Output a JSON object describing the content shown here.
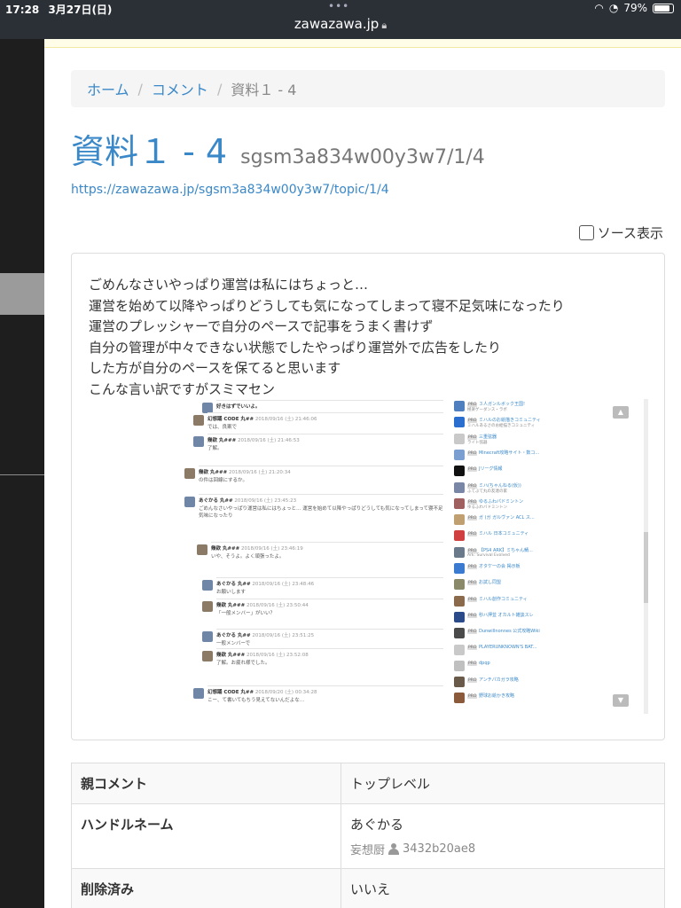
{
  "status_bar": {
    "time": "17:28",
    "date": "3月27日(日)",
    "battery": "79%"
  },
  "browser": {
    "url": "zawazawa.jp"
  },
  "breadcrumb": {
    "home": "ホーム",
    "comments": "コメント",
    "current": "資料１ - 4"
  },
  "page": {
    "title": "資料１ - 4",
    "subtitle": "sgsm3a834w00y3w7/1/4",
    "topic_url": "https://zawazawa.jp/sgsm3a834w00y3w7/topic/1/4",
    "source_toggle_label": "ソース表示"
  },
  "comment": {
    "lines": [
      "ごめんなさいやっぱり運営は私にはちょっと…",
      "運営を始めて以降やっぱりどうしても気になってしまって寝不足気味になったり",
      "運営のプレッシャーで自分のペースで記事をうまく書けず",
      "自分の管理が中々できない状態でしたやっぱり運営外で広告をしたり",
      "した方が自分のペースを保てると思います",
      "こんな言い訳ですがスミマセン"
    ]
  },
  "embed": {
    "rows": [
      {
        "name": "好きはずでいいよ。",
        "id": "",
        "body": ""
      },
      {
        "name": "幻想踊 CODE 丸##",
        "id": "2018/09/16 (土) 21:46:06",
        "body": "では、良案で"
      },
      {
        "name": "幾欲 丸###",
        "id": "2018/09/16 (土) 21:46:53",
        "body": "了解。"
      },
      {
        "name": "幾欲 丸###",
        "id": "2018/09/16 (土) 21:20:34",
        "body": "の件は回線にするか。"
      },
      {
        "name": "あぐかる 丸##",
        "id": "2018/09/16 (土) 23:45:23",
        "body": "ごめんなさいやっぱり運営は私にはちょっと… 運営を始めて以降やっぱりどうしても気になってしまって寝不足気味になったり"
      },
      {
        "name": "幾欲 丸###",
        "id": "2018/09/16 (土) 23:46:19",
        "body": "いや、そうよ。よく頑張ったよ。"
      },
      {
        "name": "あぐかる 丸##",
        "id": "2018/09/16 (土) 23:48:46",
        "body": "お願いします"
      },
      {
        "name": "幾欲 丸###",
        "id": "2018/09/16 (土) 23:50:44",
        "body": "「一般メンバー」がいい？"
      },
      {
        "name": "あぐかる 丸##",
        "id": "2018/09/16 (土) 23:51:25",
        "body": "一般メンバーで"
      },
      {
        "name": "幾欲 丸###",
        "id": "2018/09/16 (土) 23:52:08",
        "body": "了解。お疲れ様でした。"
      },
      {
        "name": "幻想踊 CODE 丸##",
        "id": "2018/09/20 (土) 00:34:28",
        "body": "こー、て書いてもちう見えてないんだよな…"
      }
    ],
    "sidebar": [
      {
        "badge": "PRO",
        "title": "３人ガンルボック王国!",
        "desc": "極楽ゲーダンス・ラボ",
        "color": "#4f7fbf"
      },
      {
        "badge": "PRO",
        "title": "ミハルのお絵描きコミュニティ",
        "desc": "ミハルあるさのお絵描きコミュニティ",
        "color": "#2a6fd0"
      },
      {
        "badge": "PRO",
        "title": "三重弦器",
        "desc": "ライト弦器",
        "color": "#c9c9c9"
      },
      {
        "badge": "PRO",
        "title": "Minecraft攻略サイト・数コ...",
        "desc": "",
        "color": "#7a9fd0"
      },
      {
        "badge": "PRO",
        "title": "Jリーグ情報",
        "desc": "",
        "color": "#111111"
      },
      {
        "badge": "PRO",
        "title": "ミハ(ちゃんねる(仮))",
        "desc": "ふてぶて丸の友達の家",
        "color": "#7a86a6"
      },
      {
        "badge": "PRO",
        "title": "ゆるふわパドミントン",
        "desc": "ゆるふわバドミントン",
        "color": "#a06060"
      },
      {
        "badge": "PRO",
        "title": "ガ (ガ ガルヴァン ACL ス...",
        "desc": "",
        "color": "#c0a070"
      },
      {
        "badge": "PRO",
        "title": "ミハル 日本コミュニティ",
        "desc": "",
        "color": "#d04040"
      },
      {
        "badge": "PRO",
        "title": "【PS4 ARK】ミちゃん鯖...",
        "desc": "Ark: Survival Evolved",
        "color": "#6a7a8a"
      },
      {
        "badge": "PRO",
        "title": "オタケ一の会 掲示板",
        "desc": "",
        "color": "#3a7ad0"
      },
      {
        "badge": "PRO",
        "title": "お試し同盟",
        "desc": "",
        "color": "#8a8a6a"
      },
      {
        "badge": "PRO",
        "title": "ミハル創作コミュニティ",
        "desc": "",
        "color": "#8a6a4a"
      },
      {
        "badge": "PRO",
        "title": "秒ハ押並 オカルト雑談スレ",
        "desc": "",
        "color": "#2a4a8a"
      },
      {
        "badge": "PRO",
        "title": "Dunwillnonnes 公式攻略Wiki",
        "desc": "",
        "color": "#4a4a4a"
      },
      {
        "badge": "PRO",
        "title": "PLAYERUNKNOWN'S BAT...",
        "desc": "",
        "color": "#c9c9c9"
      },
      {
        "badge": "PRO",
        "title": "dpqp",
        "desc": "",
        "color": "#c0c0c0"
      },
      {
        "badge": "PRO",
        "title": "アンチパカガラ攻略",
        "desc": "",
        "color": "#6a5a4a"
      },
      {
        "badge": "PRO",
        "title": "野球お絵かき攻略",
        "desc": "",
        "color": "#8a5a3a"
      }
    ]
  },
  "table": {
    "rows": [
      {
        "label": "親コメント",
        "value": "トップレベル"
      },
      {
        "label": "ハンドルネーム",
        "value": "あぐかる",
        "meta_name": "妄想厨",
        "meta_id": "3432b20ae8"
      },
      {
        "label": "削除済み",
        "value": "いいえ"
      }
    ]
  }
}
